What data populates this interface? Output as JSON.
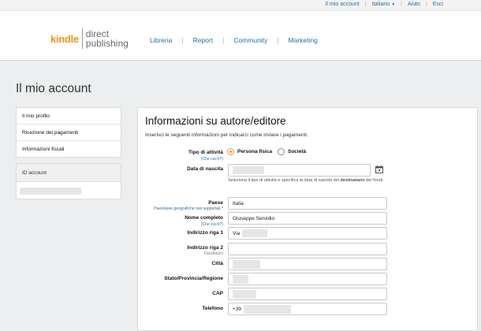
{
  "topbar": {
    "account": "Il mio account",
    "language": "Italiano",
    "help": "Aiuto",
    "logout": "Esci"
  },
  "logo": {
    "kindle": "kindle",
    "direct": "direct",
    "publishing": "publishing"
  },
  "nav": [
    "Libreria",
    "Report",
    "Community",
    "Marketing"
  ],
  "page_title": "Il mio account",
  "sidebar": {
    "items": [
      "Il mio profilo",
      "Ricezione dei pagamenti",
      "Informazioni fiscali"
    ],
    "id_account": "ID account"
  },
  "form": {
    "title": "Informazioni su autore/editore",
    "subtitle": "Inserisci le seguenti informazioni per indicarci come inviare i pagamenti.",
    "tipo_label": "Tipo di attività",
    "tipo_hint": "(Che cos'è?)",
    "radio_persona": "Persona fisica",
    "radio_societa": "Società",
    "data_label": "Data di nascita",
    "data_help_1": "Seleziona il tipo di attività e specifica la data di nascita del",
    "data_help_bold": "destinatario",
    "data_help_2": " dei fondi.",
    "paese_label": "Paese",
    "paese_hint": "Paesi/aree geografiche non supportati",
    "paese_value": "Italia",
    "nome_label": "Nome completo",
    "nome_hint": "(Che cos'è?)",
    "nome_value": "Giuseppe Servidio",
    "riga1_label": "Indirizzo riga 1",
    "riga1_value": "Via",
    "riga2_label": "Indirizzo riga 2",
    "riga2_hint": "Facoltativo",
    "citta_label": "Città",
    "stato_label": "Stato/Provincia/Regione",
    "cap_label": "CAP",
    "tel_label": "Telefono",
    "tel_value": "+39"
  },
  "colors": {
    "accent_orange": "#f0941b",
    "link_blue": "#2a6f9e",
    "radio_orange": "#e89a2c"
  }
}
